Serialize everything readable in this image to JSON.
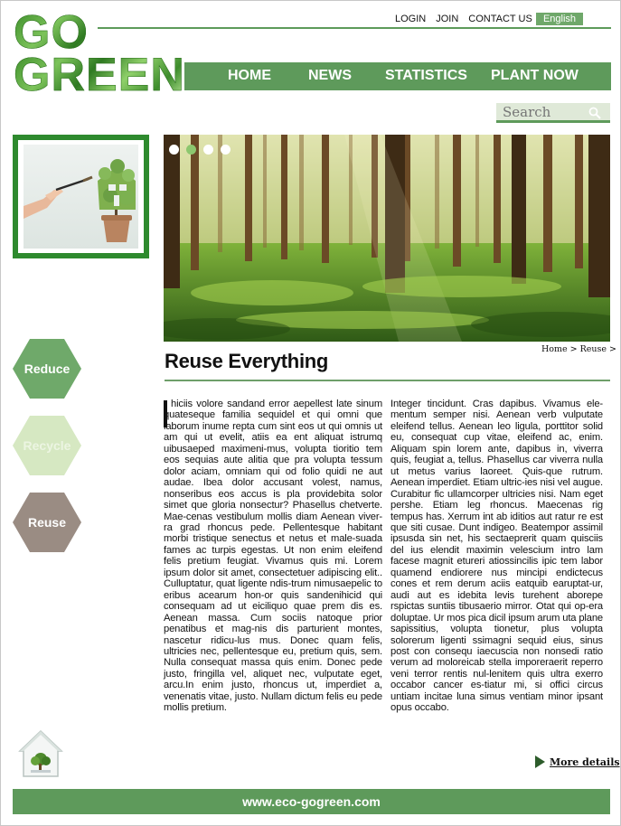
{
  "logo": {
    "line1": "GO",
    "line2": "GREEN"
  },
  "top_links": {
    "login": "LOGIN",
    "join": "JOIN",
    "contact": "CONTACT US"
  },
  "language": "English",
  "nav": {
    "home": "HOME",
    "news": "NEWS",
    "statistics": "STATISTICS",
    "plant_now": "PLANT NOW"
  },
  "search": {
    "placeholder": "Search"
  },
  "hex_buttons": {
    "reduce": "Reduce",
    "recycle": "Recycle",
    "reuse": "Reuse"
  },
  "slider": {
    "active_index": 2,
    "count": 4
  },
  "breadcrumb": "Home > Reuse >",
  "article": {
    "title": "Reuse Everything",
    "col_left": "hiciis volore sandand error aepellest late sinum quateseque familia sequidel et qui omni que laborum inume repta cum sint eos ut qui omnis ut am qui ut evelit, atiis ea ent aliquat istrumq uibusaeped maximeni-mus, volupta tioritio tem eos sequias aute alitia que pra volupta tessum dolor aciam, omniam qui od folio quidi ne aut audae. Ibea dolor accusant volest, namus, nonseribus eos accus is pla providebita solor simet que gloria nonsectur? Phasellus chetverte. Mae-cenas vestibulum mollis diam Aenean viver-ra grad rhoncus pede. Pellentesque habitant morbi tristique senectus et netus et male-suada fames ac turpis egestas. Ut non enim eleifend felis pretium feugiat. Vivamus quis mi. Lorem ipsum dolor sit amet, consectetuer adipiscing elit.. Culluptatur, quat ligente ndis-trum nimusaepelic to eribus acearum hon-or quis sandenihicid qui consequam ad ut eiciliquo quae prem dis es. Aenean massa. Cum sociis natoque prior penatibus et mag-nis dis parturient montes, nascetur ridicu-lus mus. Donec quam felis, ultricies nec, pellentesque eu, pretium quis, sem. Nulla consequat massa quis enim. Donec pede justo, fringilla vel, aliquet nec, vulputate eget, arcu.In enim justo, rhoncus ut, imperdiet a, venenatis vitae, justo. Nullam dictum felis eu pede mollis pretium.",
    "col_right": "Integer tincidunt. Cras dapibus. Vivamus ele-mentum semper nisi. Aenean verb vulputate eleifend tellus. Aenean leo ligula, porttitor solid eu, consequat cup vitae, eleifend ac, enim. Aliquam spin lorem ante, dapibus in, viverra quis, feugiat a, tellus. Phasellus car viverra nulla ut metus varius laoreet. Quis-que rutrum. Aenean imperdiet. Etiam ultric-ies nisi vel augue. Curabitur fic ullamcorper ultricies nisi. Nam eget pershe. Etiam leg rhoncus. Maecenas rig tempus has. Xerrum int ab iditios aut ratur re est que siti cusae. Dunt indigeo. Beatempor assimil ipsusda sin net, his sectaeprerit quam quisciis del ius elendit maximin velescium intro lam facese magnit etureri atiossincilis ipic tem labor quamend endiorere nus mincipi endictecus cones et rem derum aciis eatquib earuptat-ur, audi aut es idebita levis turehent aborepe rspictas suntiis tibusaerio mirror. Otat qui op-era doluptae. Ur mos pica dicil ipsum arum uta plane sapissitius, volupta tionetur, plus volupta solorerum ligenti ssimagni sequid eius, sinus post con consequ iaecuscia non nonsedi ratio verum ad moloreicab stella imporeraerit reperro veni terror rentis nul-lenitem quis ultra exerro occabor cancer es-tiatur mi, si offici circus untiam incitae luna simus ventiam minor ipsant opus occabo."
  },
  "more_details": "More details",
  "footer": "www.eco-gogreen.com",
  "colors": {
    "brand_green": "#5e9a5b",
    "frame_green": "#2e8a2e",
    "reduce": "#6fa96a",
    "recycle": "#d6e8c2",
    "reuse": "#9a8c83"
  }
}
